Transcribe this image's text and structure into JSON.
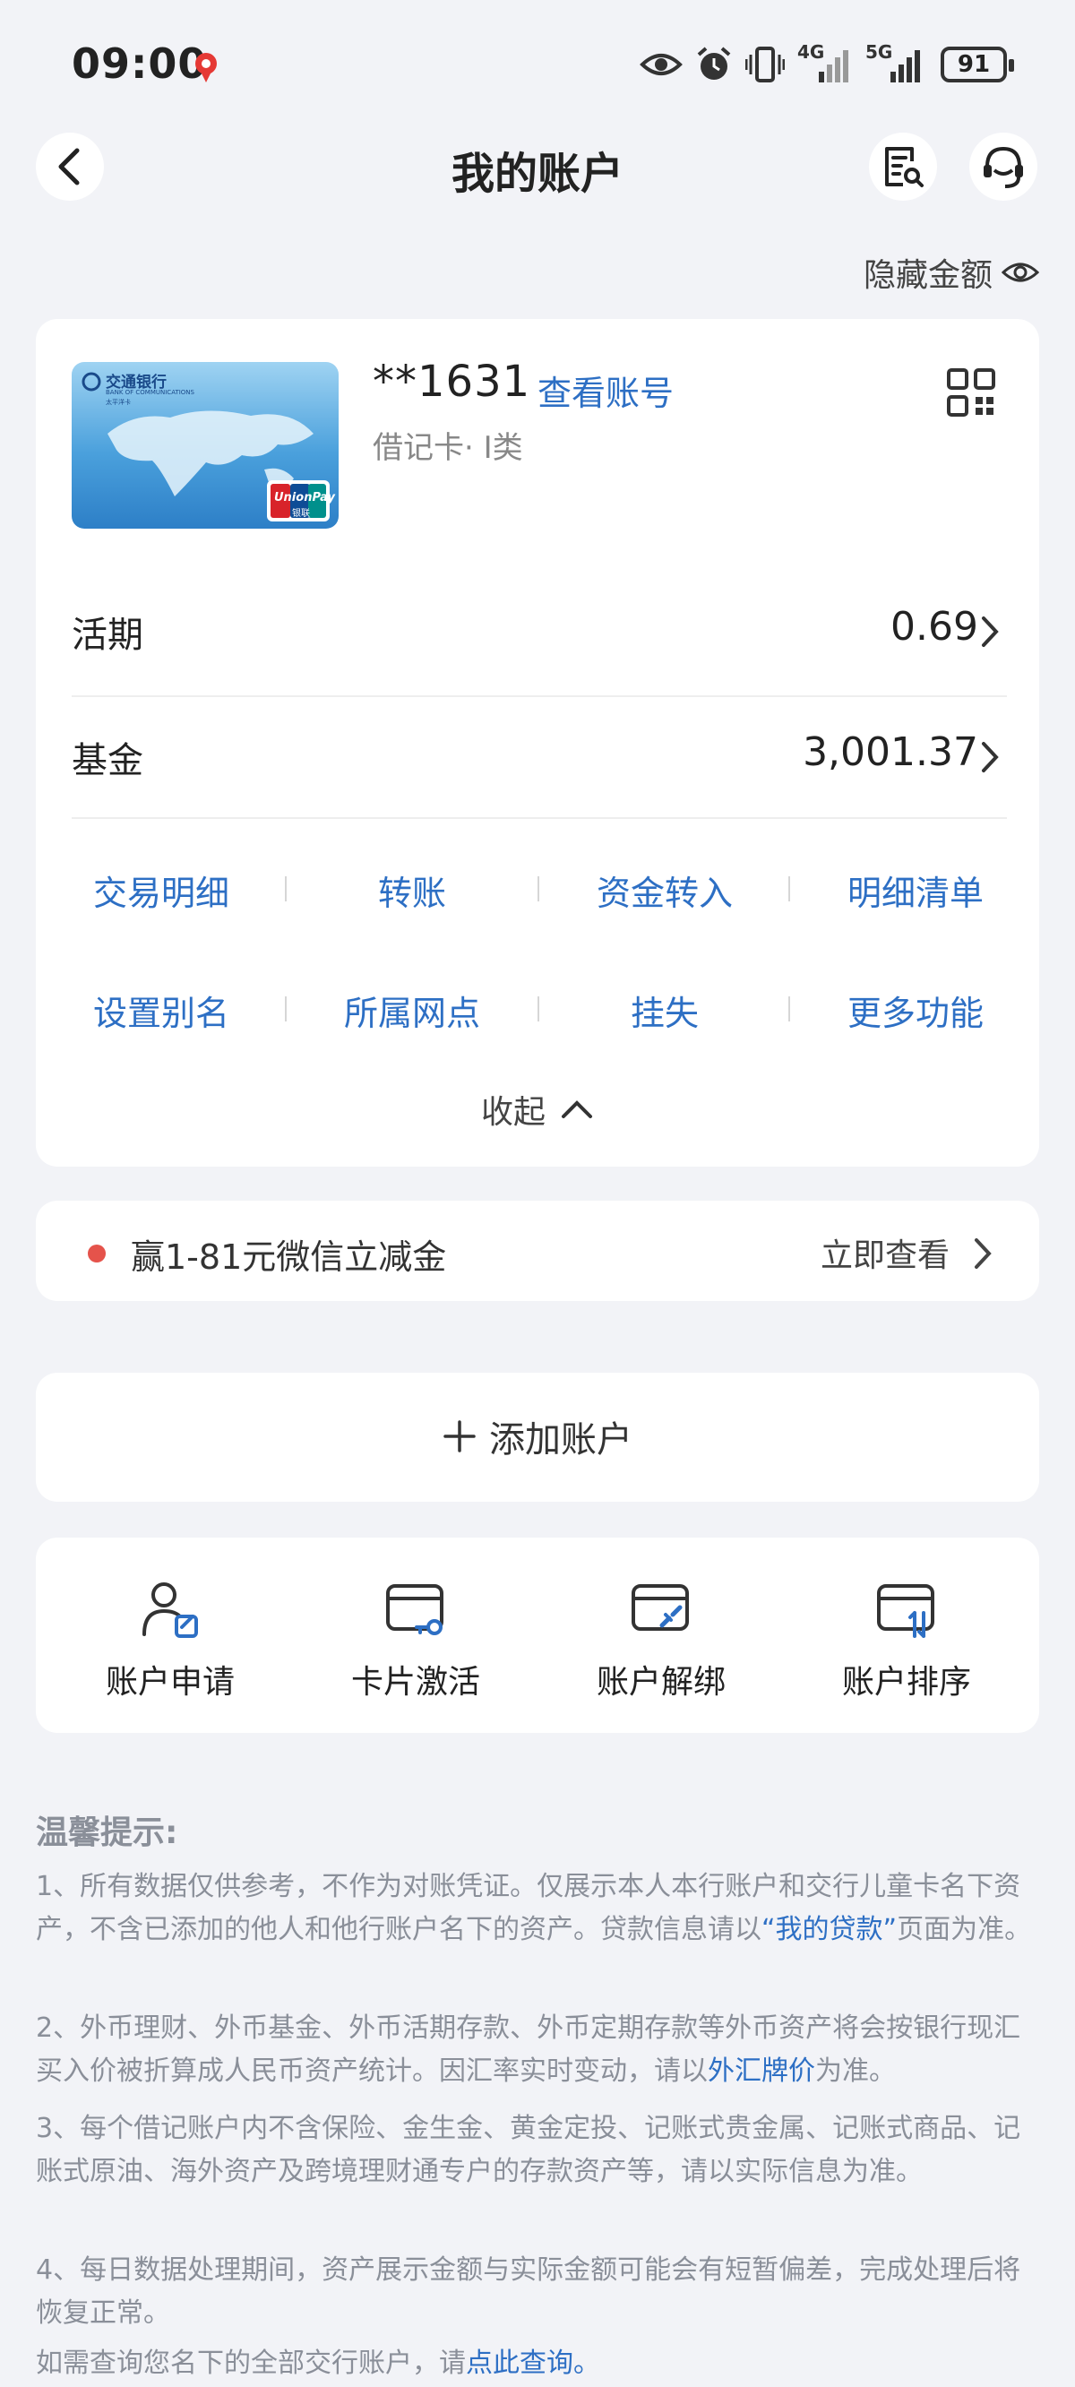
{
  "status_bar": {
    "time": "09:00",
    "network_4g": "4G",
    "network_5g": "5G",
    "battery": "91",
    "icons": [
      "location-pin-icon",
      "eye-icon",
      "alarm-icon",
      "vibrate-icon",
      "signal-4g-icon",
      "signal-5g-icon",
      "battery-icon"
    ]
  },
  "header": {
    "title": "我的账户",
    "back_icon": "back-chevron-icon",
    "bill_icon": "bill-search-icon",
    "service_icon": "customer-service-icon"
  },
  "hide_amount_label": "隐藏金额",
  "account": {
    "masked_number": "**1631",
    "view_number_label": "查看账号",
    "card_type": "借记卡· Ⅰ类",
    "bank_card_lines": [
      "交通银行",
      "BANK OF COMMUNICATIONS",
      "太平洋卡"
    ],
    "unionpay_text": "UnionPay",
    "unionpay_cn": "银联",
    "rows": [
      {
        "label": "活期",
        "value": "0.69"
      },
      {
        "label": "基金",
        "value": "3,001.37"
      }
    ],
    "actions_row1": [
      "交易明细",
      "转账",
      "资金转入",
      "明细清单"
    ],
    "actions_row2": [
      "设置别名",
      "所属网点",
      "挂失",
      "更多功能"
    ],
    "collapse_label": "收起"
  },
  "promo": {
    "text": "赢1-81元微信立减金",
    "action": "立即查看"
  },
  "add_account_label": "添加账户",
  "tools": [
    {
      "label": "账户申请",
      "icon": "account-apply-icon"
    },
    {
      "label": "卡片激活",
      "icon": "card-activate-icon"
    },
    {
      "label": "账户解绑",
      "icon": "account-unbind-icon"
    },
    {
      "label": "账户排序",
      "icon": "account-sort-icon"
    }
  ],
  "tips": {
    "title": "温馨提示:",
    "tip1_pre": "1、所有数据仅供参考，不作为对账凭证。仅展示本人本行账户和交行儿童卡名下资产，不含已添加的他人和他行账户名下的资产。贷款信息请以",
    "tip1_link": "“我的贷款”",
    "tip1_post": "页面为准。",
    "tip2_pre": "2、外币理财、外币基金、外币活期存款、外币定期存款等外币资产将会按银行现汇买入价被折算成人民币资产统计。因汇率实时变动，请以",
    "tip2_link": "外汇牌价",
    "tip2_post": "为准。",
    "tip3": "3、每个借记账户内不含保险、金生金、黄金定投、记账式贵金属、记账式商品、记账式原油、海外资产及跨境理财通专户的存款资产等，请以实际信息为准。",
    "tip4": "4、每日数据处理期间，资产展示金额与实际金额可能会有短暂偏差，完成处理后将恢复正常。",
    "tip5_pre": "如需查询您名下的全部交行账户，请",
    "tip5_link": "点此查询。"
  },
  "colors": {
    "accent": "#2d6fc4",
    "background": "#f2f3f7",
    "promo_dot": "#e5534b"
  }
}
